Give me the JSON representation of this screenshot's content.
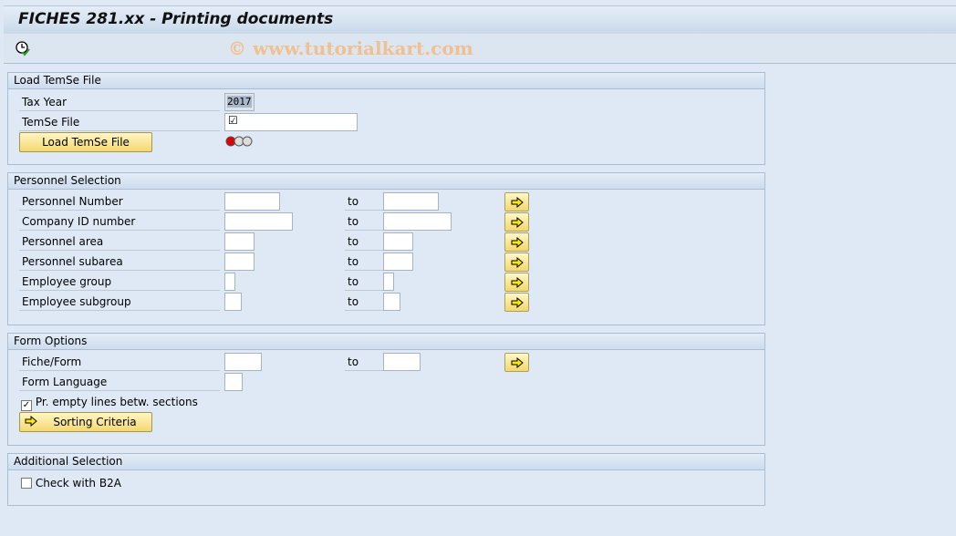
{
  "title": "FICHES 281.xx - Printing documents",
  "watermark": "© www.tutorialkart.com",
  "toolbar": {
    "execute_icon": "clock-execute-icon"
  },
  "load": {
    "header": "Load TemSe File",
    "tax_year_label": "Tax Year",
    "tax_year_value": "2017",
    "temse_label": "TemSe File",
    "temse_value": "",
    "button": "Load TemSe File",
    "status": "red"
  },
  "personnel": {
    "header": "Personnel Selection",
    "to": "to",
    "rows": [
      {
        "label": "Personnel Number",
        "from": "",
        "to": ""
      },
      {
        "label": "Company ID number",
        "from": "",
        "to": ""
      },
      {
        "label": "Personnel area",
        "from": "",
        "to": ""
      },
      {
        "label": "Personnel subarea",
        "from": "",
        "to": ""
      },
      {
        "label": "Employee group",
        "from": "",
        "to": ""
      },
      {
        "label": "Employee subgroup",
        "from": "",
        "to": ""
      }
    ]
  },
  "form": {
    "header": "Form Options",
    "fiche_label": "Fiche/Form",
    "to": "to",
    "language_label": "Form Language",
    "empty_lines_label": "Pr. empty lines betw. sections",
    "empty_lines_checked": true,
    "sorting_button": "Sorting Criteria"
  },
  "additional": {
    "header": "Additional Selection",
    "b2a_label": "Check with B2A",
    "b2a_checked": false
  },
  "colors": {
    "background": "#dfe9f5",
    "button": "#f4d870",
    "status_red": "#e00000"
  }
}
